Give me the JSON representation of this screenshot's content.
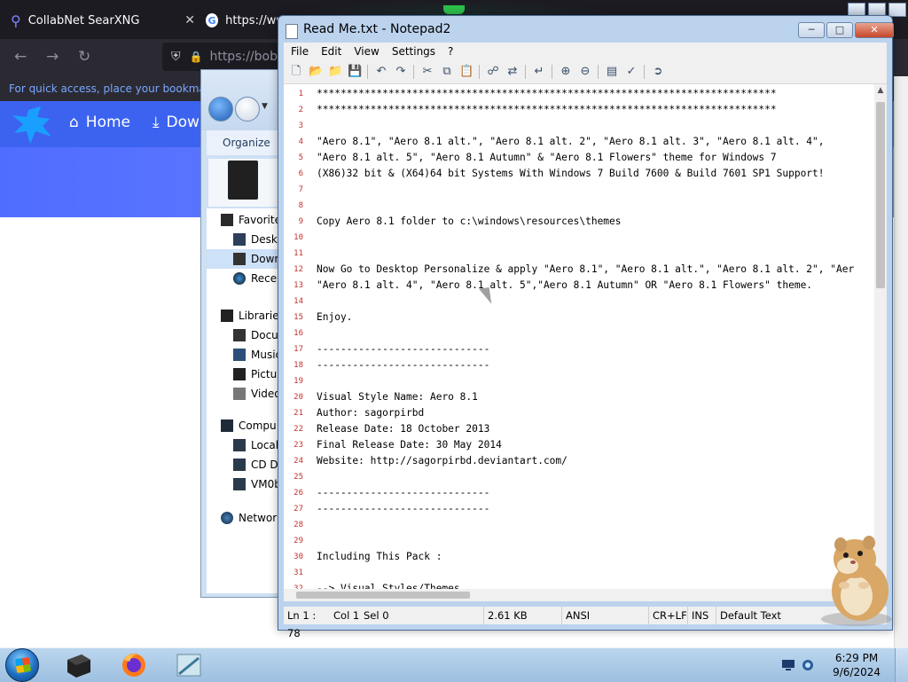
{
  "browser": {
    "tab1_label": "CollabNet SearXNG",
    "tab2_label": "https://ww",
    "url": "https://bob",
    "bookmark_hint": "For quick access, place your bookmarks l",
    "site_nav": {
      "home": "Home",
      "downloads": "Dow"
    }
  },
  "explorer": {
    "organize": "Organize",
    "favorites": "Favorite",
    "desktop": "Deskt",
    "downloads": "Dowr",
    "recent": "Recer",
    "libraries": "Librarie",
    "documents": "Docu",
    "music": "Music",
    "pictures": "Pictu",
    "videos": "Video",
    "computer": "Compu",
    "local": "Local",
    "cd": "CD D",
    "vm": "VM0b",
    "network": "Networ"
  },
  "notepad": {
    "title": "Read Me.txt - Notepad2",
    "menu": [
      "File",
      "Edit",
      "View",
      "Settings",
      "?"
    ],
    "lines": [
      {
        "n": "1",
        "t": "*****************************************************************************"
      },
      {
        "n": "2",
        "t": "*****************************************************************************"
      },
      {
        "n": "3",
        "t": ""
      },
      {
        "n": "4",
        "t": "\"Aero 8.1\", \"Aero 8.1 alt.\", \"Aero 8.1 alt. 2\", \"Aero 8.1 alt. 3\", \"Aero 8.1 alt. 4\","
      },
      {
        "n": "5",
        "t": "\"Aero 8.1 alt. 5\", \"Aero 8.1 Autumn\" & \"Aero 8.1 Flowers\" theme for Windows 7"
      },
      {
        "n": "6",
        "t": "(X86)32 bit & (X64)64 bit Systems With Windows 7 Build 7600 & Build 7601 SP1 Support!"
      },
      {
        "n": "7",
        "t": ""
      },
      {
        "n": "8",
        "t": ""
      },
      {
        "n": "9",
        "t": "Copy Aero 8.1 folder to c:\\windows\\resources\\themes"
      },
      {
        "n": "10",
        "t": ""
      },
      {
        "n": "11",
        "t": ""
      },
      {
        "n": "12",
        "t": "Now Go to Desktop Personalize & apply \"Aero 8.1\", \"Aero 8.1 alt.\", \"Aero 8.1 alt. 2\", \"Aer"
      },
      {
        "n": "13",
        "t": "\"Aero 8.1 alt. 4\", \"Aero 8.1 alt. 5\",\"Aero 8.1 Autumn\" OR \"Aero 8.1 Flowers\" theme."
      },
      {
        "n": "14",
        "t": ""
      },
      {
        "n": "15",
        "t": "Enjoy."
      },
      {
        "n": "16",
        "t": ""
      },
      {
        "n": "17",
        "t": "-----------------------------"
      },
      {
        "n": "18",
        "t": "-----------------------------"
      },
      {
        "n": "19",
        "t": ""
      },
      {
        "n": "20",
        "t": "Visual Style Name: Aero 8.1"
      },
      {
        "n": "21",
        "t": "Author: sagorpirbd"
      },
      {
        "n": "22",
        "t": "Release Date: 18 October 2013"
      },
      {
        "n": "23",
        "t": "Final Release Date: 30 May 2014"
      },
      {
        "n": "24",
        "t": "Website: http://sagorpirbd.deviantart.com/"
      },
      {
        "n": "25",
        "t": ""
      },
      {
        "n": "26",
        "t": "-----------------------------"
      },
      {
        "n": "27",
        "t": "-----------------------------"
      },
      {
        "n": "28",
        "t": ""
      },
      {
        "n": "29",
        "t": ""
      },
      {
        "n": "30",
        "t": "Including This Pack :"
      },
      {
        "n": "31",
        "t": ""
      },
      {
        "n": "32",
        "t": "--> Visual Styles/Themes."
      }
    ],
    "status": {
      "position": "Ln 1 : 78",
      "col": "Col 1",
      "sel": "Sel 0",
      "size": "2.61 KB",
      "encoding": "ANSI",
      "eol": "CR+LF",
      "ins": "INS",
      "scheme": "Default Text"
    }
  },
  "taskbar": {
    "time": "6:29 PM",
    "date": "9/6/2024"
  },
  "colors": {
    "accent": "#3c63f0",
    "line_number": "#c03030",
    "browser_dark": "#1c1b22"
  }
}
